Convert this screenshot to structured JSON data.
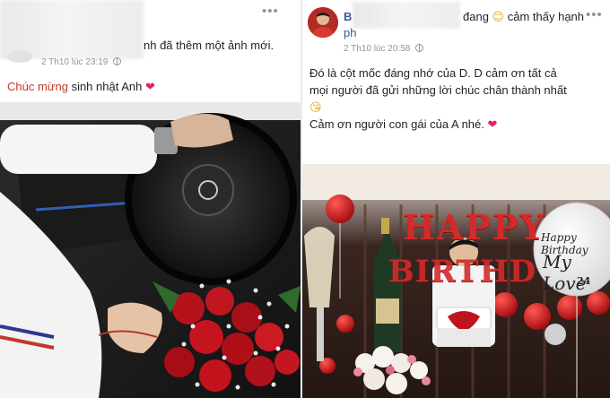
{
  "left_post": {
    "action_text": "nh đã thêm một ảnh mới.",
    "timestamp": "2 Th10 lúc 23:19",
    "link_text": "Chúc mừng",
    "body_text": " sinh nhật Anh",
    "heart": "❤",
    "more": "•••"
  },
  "right_post": {
    "name_initial": "B",
    "status_text": "đang",
    "smile_emoji": "😊",
    "status_text_2": "cảm thấy hạnh",
    "name_cont": "ph",
    "timestamp": "2 Th10 lúc 20:58",
    "body_line_1": "Đó là cột mốc đáng nhớ của D. D cảm ơn tất cả",
    "body_line_2": "mọi người đã gửi những lời chúc chân thành nhất",
    "kiss_emoji": "😘",
    "body_line_3": "Cảm ơn người con gái của A nhé.",
    "heart": "❤",
    "more": "•••"
  },
  "photo_texts": {
    "happy": "HAPPY",
    "birthday_balloon_letters": "BIRTHD",
    "balloon_happy_birthday": "Happy Birthday",
    "balloon_my_love": "My Love",
    "balloon_age": "24"
  },
  "colors": {
    "link": "#c0392b",
    "meta": "#90949c",
    "balloon_red": "#d42a2a"
  },
  "icons": {
    "globe": "globe-icon",
    "more": "more-options-icon"
  }
}
